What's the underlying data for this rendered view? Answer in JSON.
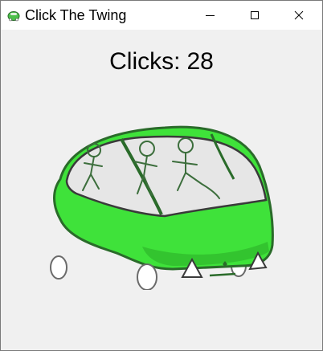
{
  "window": {
    "title": "Click The Twing",
    "controls": {
      "minimize_icon": "minimize-icon",
      "maximize_icon": "maximize-icon",
      "close_icon": "close-icon"
    }
  },
  "counter": {
    "label": "Clicks:",
    "value": "28"
  },
  "twing": {
    "icon": "twing-car-image",
    "body_color": "#3fe23a",
    "outline_color": "#2a6b2a",
    "window_color": "#e6e6e6"
  },
  "colors": {
    "background": "#f0f0f0",
    "titlebar": "#ffffff"
  }
}
